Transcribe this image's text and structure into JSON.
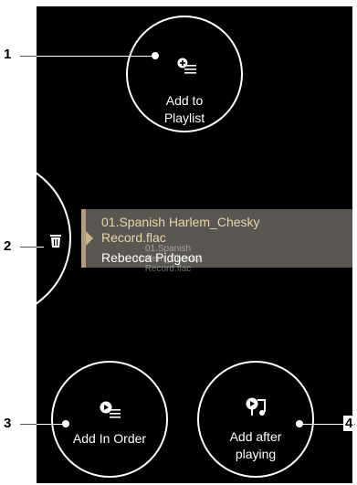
{
  "callouts": [
    "1",
    "2",
    "3",
    "4"
  ],
  "actions": {
    "add_to_playlist": {
      "label_line1": "Add to",
      "label_line2": "Playlist",
      "icon": "add-to-playlist-icon"
    },
    "delete": {
      "icon": "trash-icon"
    },
    "add_in_order": {
      "label": "Add In Order",
      "icon": "play-queue-icon"
    },
    "add_after_playing": {
      "label_line1": "Add after",
      "label_line2": "playing",
      "icon": "play-next-icon"
    }
  },
  "track": {
    "title": "01.Spanish Harlem_Chesky Record.flac",
    "artist": "Rebecca Pidgeon",
    "ghost_line1": "01.Spanish Harlem_Chesky",
    "ghost_line2": "Record.flac"
  },
  "colors": {
    "background": "#000000",
    "card": "#5a5752",
    "accent": "#b59d78",
    "title_text": "#e7d4a8"
  }
}
